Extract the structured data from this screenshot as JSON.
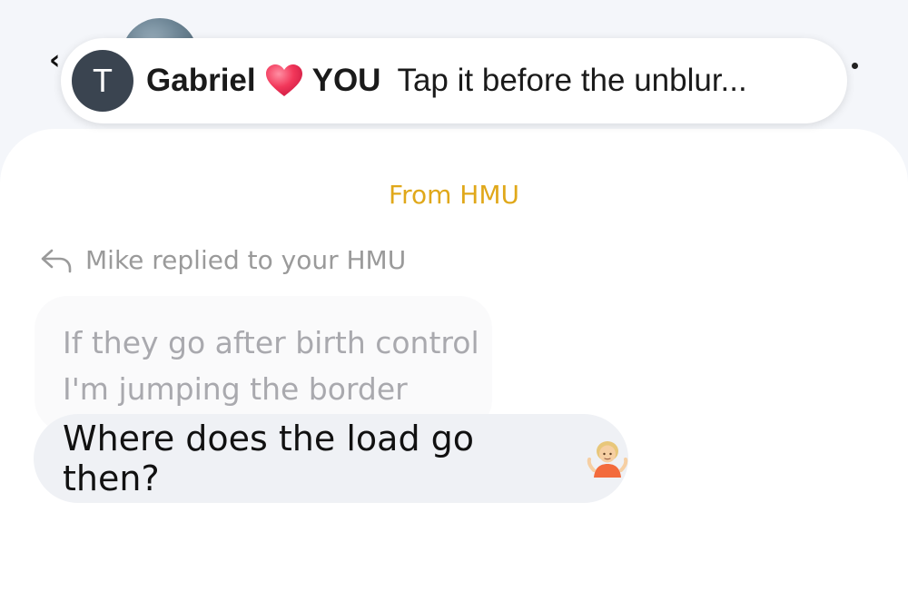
{
  "notification": {
    "avatar_initial": "T",
    "sender": "Gabriel",
    "heart_icon": "red-heart-icon",
    "recipient": "YOU",
    "message": "Tap it before the unblur..."
  },
  "chat": {
    "source_label": "From HMU",
    "reply_info": "Mike replied to your HMU",
    "quoted_lines": [
      "If they go after birth control",
      "I'm jumping the border"
    ],
    "message": "Where does the load go then?",
    "message_emoji_icon": "person-shrugging-icon"
  },
  "colors": {
    "accent": "#e0a81a",
    "bubble": "#eff1f5",
    "avatar": "#3a4450"
  }
}
